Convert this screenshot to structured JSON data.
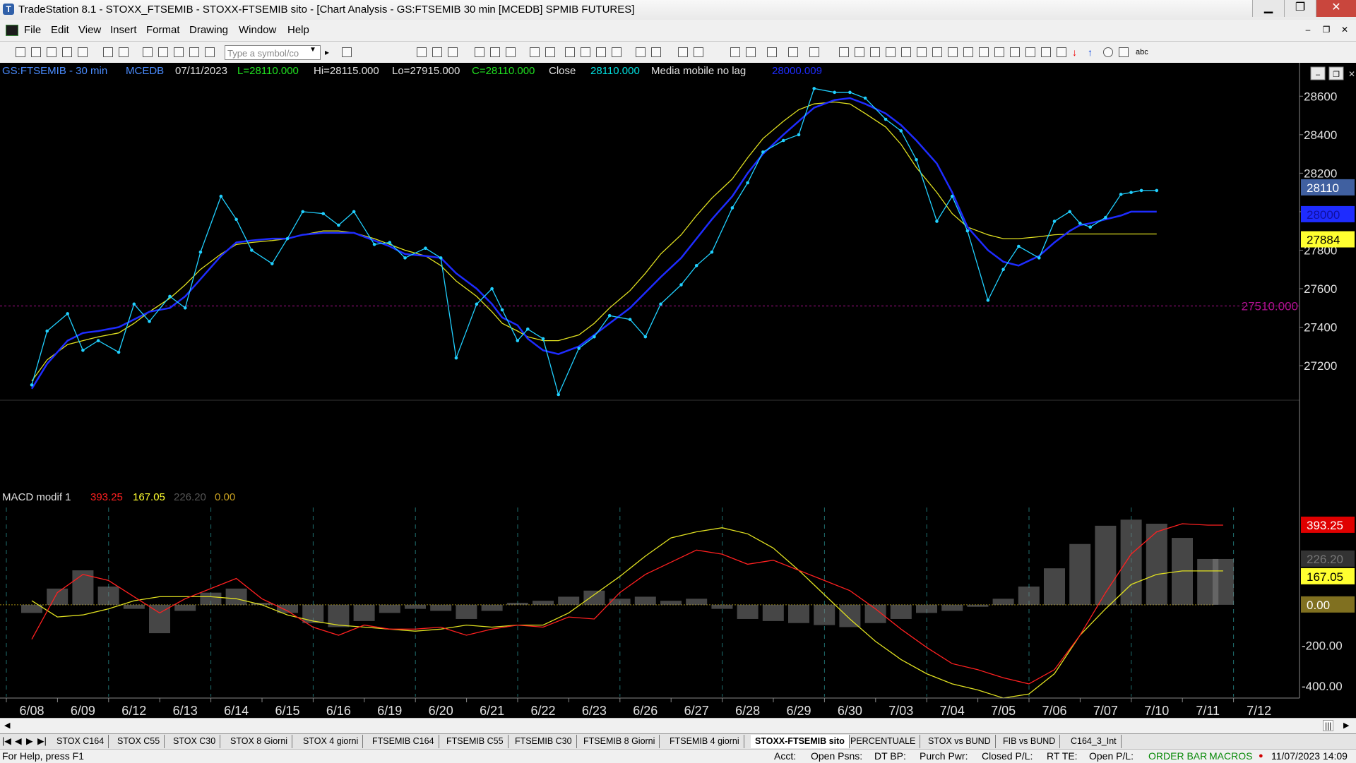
{
  "window": {
    "title": "TradeStation 8.1 - STOXX_FTSEMIB - STOXX-FTSEMIB sito - [Chart Analysis - GS:FTSEMIB  30 min  [MCEDB] SPMIB FUTURES]",
    "min_glyph": "▁",
    "max_glyph": "❐",
    "close_glyph": "✕"
  },
  "menu": {
    "items": [
      "File",
      "Edit",
      "View",
      "Insert",
      "Format",
      "Drawing",
      "Window",
      "Help"
    ],
    "mdi_min": "–",
    "mdi_restore": "❐",
    "mdi_close": "✕"
  },
  "toolbar": {
    "symbol_placeholder": "Type a symbol/co",
    "arrow_glyph": "▸",
    "text_tool": "abc"
  },
  "legend": {
    "symbol": "GS:FTSEMIB - 30 min",
    "feed": "MCEDB",
    "date": "07/11/2023",
    "last": "L=28110.000",
    "high": "Hi=28115.000",
    "low": "Lo=27915.000",
    "close_eq": "C=28110.000",
    "close_word": "Close",
    "close_val": "28110.000",
    "ma_name": "Media mobile no lag",
    "ma_val": "28000.009"
  },
  "macd_legend": {
    "name": "MACD modif 1",
    "v1": "393.25",
    "v2": "167.05",
    "v3": "226.20",
    "v4": "0.00"
  },
  "price_badges": {
    "last": "28110",
    "ma_blue": "28000",
    "ma_yellow": "27884",
    "hline": "27510.000"
  },
  "macd_badges": {
    "red": "393.25",
    "gray": "226.20",
    "yellow": "167.05",
    "zero": "0.00"
  },
  "colors": {
    "price": "#20d0ff",
    "ma_blue": "#1e2cff",
    "ma_yellow": "#e0e020",
    "macd_red": "#ff2020",
    "macd_signal": "#e0e020",
    "histogram": "#808080",
    "hline": "#b01090",
    "legend_symbol": "#4a8cff",
    "legend_green": "#20e020",
    "legend_cyan": "#00e0e0",
    "badge_yellow": "#ffff30"
  },
  "chart_data": [
    {
      "type": "line",
      "name": "price",
      "x_ticks": [
        "6/08",
        "6/09",
        "6/12",
        "6/13",
        "6/14",
        "6/15",
        "6/16",
        "6/19",
        "6/20",
        "6/21",
        "6/22",
        "6/23",
        "6/26",
        "6/27",
        "6/28",
        "6/29",
        "6/30",
        "7/03",
        "7/04",
        "7/05",
        "7/06",
        "7/07",
        "7/10",
        "7/11",
        "7/12"
      ],
      "y_ticks": [
        27200,
        27400,
        27600,
        27800,
        28000,
        28200,
        28400,
        28600
      ],
      "ylim": [
        27050,
        28700
      ],
      "hline": 27510,
      "x": [
        0,
        0.3,
        0.7,
        1,
        1.3,
        1.7,
        2,
        2.3,
        2.7,
        3,
        3.3,
        3.7,
        4,
        4.3,
        4.7,
        5,
        5.3,
        5.7,
        6,
        6.3,
        6.7,
        7,
        7.3,
        7.7,
        8,
        8.3,
        8.7,
        9,
        9.2,
        9.5,
        9.7,
        10,
        10.3,
        10.7,
        11,
        11.3,
        11.7,
        12,
        12.3,
        12.7,
        13,
        13.3,
        13.7,
        14,
        14.3,
        14.7,
        15,
        15.3,
        15.7,
        16,
        16.3,
        16.7,
        17,
        17.3,
        17.7,
        18,
        18.3,
        18.7,
        19,
        19.3,
        19.7,
        20,
        20.3,
        20.5,
        20.7,
        21,
        21.3,
        21.5,
        21.7,
        22,
        22.3,
        22.7,
        23,
        23.3
      ],
      "close": [
        27100,
        27380,
        27470,
        27280,
        27330,
        27270,
        27520,
        27430,
        27560,
        27500,
        27790,
        28080,
        27960,
        27800,
        27730,
        27860,
        28000,
        27990,
        27930,
        28000,
        27830,
        27840,
        27760,
        27810,
        27760,
        27240,
        27520,
        27600,
        27490,
        27330,
        27390,
        27340,
        27050,
        27290,
        27350,
        27460,
        27440,
        27350,
        27520,
        27620,
        27720,
        27790,
        28020,
        28150,
        28310,
        28370,
        28400,
        28640,
        28620,
        28620,
        28590,
        28480,
        28420,
        28270,
        27950,
        28080,
        27900,
        27540,
        27700,
        27820,
        27760,
        27950,
        28000,
        27940,
        27920,
        27970,
        28090,
        28100,
        28110,
        28110
      ],
      "series_ma": [
        {
          "key": "ma_blue",
          "values": [
            27080,
            27210,
            27330,
            27370,
            27380,
            27400,
            27440,
            27480,
            27500,
            27560,
            27650,
            27770,
            27840,
            27850,
            27860,
            27860,
            27880,
            27890,
            27890,
            27890,
            27850,
            27820,
            27780,
            27770,
            27760,
            27680,
            27600,
            27520,
            27450,
            27410,
            27340,
            27280,
            27260,
            27300,
            27360,
            27420,
            27500,
            27580,
            27660,
            27760,
            27860,
            27960,
            28080,
            28200,
            28300,
            28400,
            28470,
            28540,
            28580,
            28590,
            28560,
            28510,
            28450,
            28370,
            28250,
            28100,
            27920,
            27800,
            27740,
            27720,
            27770,
            27840,
            27900,
            27930,
            27940,
            27960,
            27980,
            28000,
            28000,
            28000
          ]
        },
        {
          "key": "ma_yellow",
          "values": [
            27120,
            27230,
            27310,
            27330,
            27350,
            27370,
            27420,
            27480,
            27550,
            27620,
            27700,
            27780,
            27830,
            27840,
            27850,
            27860,
            27880,
            27900,
            27900,
            27890,
            27860,
            27830,
            27800,
            27770,
            27720,
            27640,
            27560,
            27480,
            27420,
            27380,
            27350,
            27330,
            27330,
            27360,
            27420,
            27500,
            27590,
            27680,
            27780,
            27880,
            27980,
            28070,
            28170,
            28280,
            28380,
            28470,
            28530,
            28560,
            28570,
            28560,
            28510,
            28440,
            28350,
            28230,
            28100,
            27990,
            27920,
            27880,
            27860,
            27860,
            27870,
            27880,
            27884,
            27884,
            27884,
            27884,
            27884,
            27884,
            27884,
            27884
          ]
        }
      ]
    },
    {
      "type": "line",
      "name": "MACD modif 1",
      "ylim": [
        -460,
        480
      ],
      "y_ticks": [
        -400,
        -200,
        0
      ],
      "x": [
        0,
        0.5,
        1,
        1.5,
        2,
        2.5,
        3,
        3.5,
        4,
        4.5,
        5,
        5.5,
        6,
        6.5,
        7,
        7.5,
        8,
        8.5,
        9,
        9.5,
        10,
        10.5,
        11,
        11.5,
        12,
        12.5,
        13,
        13.5,
        14,
        14.5,
        15,
        15.5,
        16,
        16.5,
        17,
        17.5,
        18,
        18.5,
        19,
        19.5,
        20,
        20.5,
        21,
        21.5,
        22,
        22.5,
        23,
        23.3
      ],
      "macd": [
        -170,
        60,
        150,
        120,
        40,
        -40,
        30,
        80,
        130,
        30,
        -30,
        -110,
        -150,
        -100,
        -120,
        -120,
        -110,
        -150,
        -120,
        -100,
        -110,
        -60,
        -70,
        60,
        150,
        210,
        270,
        250,
        200,
        220,
        170,
        120,
        70,
        -20,
        -120,
        -210,
        -290,
        -320,
        -360,
        -390,
        -320,
        -150,
        60,
        250,
        360,
        400,
        393,
        393
      ],
      "signal": [
        20,
        -60,
        -50,
        -20,
        20,
        40,
        40,
        40,
        30,
        0,
        -50,
        -80,
        -100,
        -110,
        -120,
        -130,
        -120,
        -100,
        -110,
        -100,
        -100,
        -40,
        50,
        140,
        240,
        330,
        360,
        380,
        350,
        280,
        170,
        50,
        -70,
        -180,
        -270,
        -340,
        -390,
        -420,
        -460,
        -440,
        -340,
        -150,
        -20,
        100,
        150,
        167,
        167,
        167
      ],
      "histogram": [
        -40,
        80,
        170,
        90,
        -20,
        -140,
        -30,
        60,
        80,
        10,
        -40,
        -90,
        -110,
        -80,
        -40,
        -20,
        -30,
        -70,
        -30,
        10,
        20,
        40,
        70,
        30,
        40,
        20,
        30,
        -20,
        -70,
        -80,
        -90,
        -100,
        -110,
        -90,
        -70,
        -40,
        -30,
        -10,
        30,
        90,
        180,
        300,
        390,
        420,
        400,
        330,
        226,
        226
      ]
    }
  ],
  "x_axis": {
    "labels": [
      "6/08",
      "6/09",
      "6/12",
      "6/13",
      "6/14",
      "6/15",
      "6/16",
      "6/19",
      "6/20",
      "6/21",
      "6/22",
      "6/23",
      "6/26",
      "6/27",
      "6/28",
      "6/29",
      "6/30",
      "7/03",
      "7/04",
      "7/05",
      "7/06",
      "7/07",
      "7/10",
      "7/11",
      "7/12"
    ]
  },
  "price_axis_labels": [
    "28600",
    "28400",
    "28200",
    "28000",
    "27800",
    "27600",
    "27400",
    "27200"
  ],
  "macd_axis_labels": [
    "-200.00",
    "-400.00"
  ],
  "tabs": [
    "STOX C164",
    "STOX C55",
    "STOX  C30",
    "STOX  8 Giorni",
    "STOX 4 giorni",
    "FTSEMIB C164",
    "FTSEMIB C55",
    "FTSEMIB C30",
    "FTSEMIB  8 Giorni",
    "FTSEMIB  4 giorni",
    "STOXX-FTSEMIB sito",
    "PERCENTUALE",
    "STOX vs BUND",
    "FIB vs BUND",
    "C164_3_Int"
  ],
  "active_tab": "STOXX-FTSEMIB sito",
  "tab_nav": [
    "|◀",
    "◀",
    "▶",
    "▶|"
  ],
  "status": {
    "help": "For Help, press F1",
    "acct": "Acct:",
    "open_psns": "Open Psns:",
    "dt_bp": "DT BP:",
    "purch_pwr": "Purch Pwr:",
    "closed_pl": "Closed P/L:",
    "rt_te": "RT TE:",
    "open_pl": "Open P/L:",
    "order_bar": "ORDER BAR",
    "macros": "MACROS",
    "datetime": "11/07/2023 14:09"
  },
  "scroll": {
    "left_glyph": "◀",
    "right_glyph": "▶",
    "grip_glyph": "|||"
  }
}
